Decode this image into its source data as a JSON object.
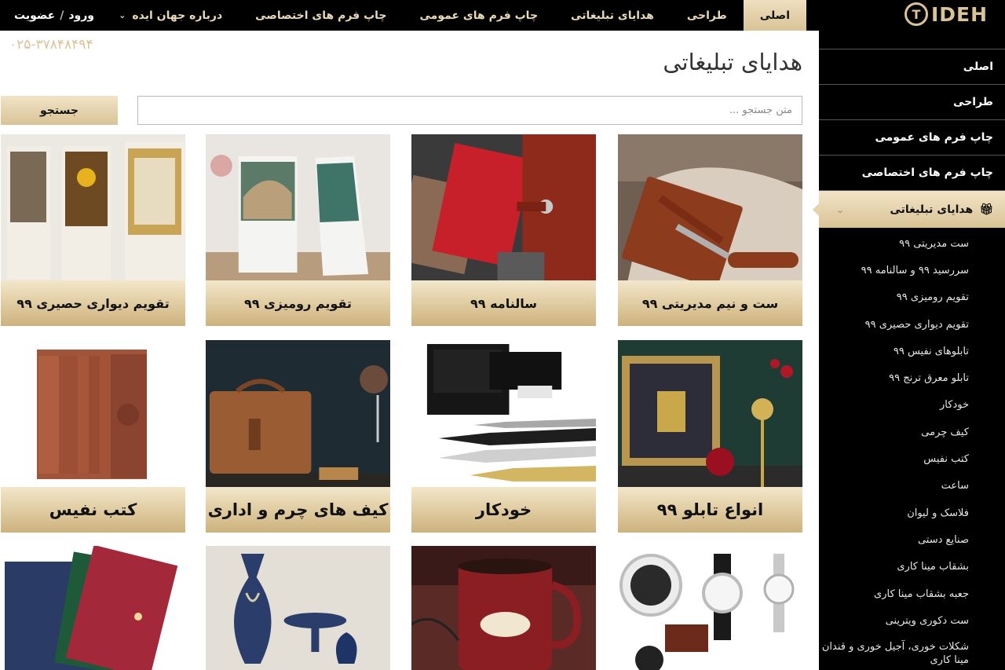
{
  "header": {
    "nav": [
      {
        "label": "اصلی",
        "active": true
      },
      {
        "label": "طراحی"
      },
      {
        "label": "هدایای تبلیغاتی"
      },
      {
        "label": "چاپ فرم های عمومی"
      },
      {
        "label": "چاپ فرم های اختصاصی"
      },
      {
        "label": "درباره جهان ایده",
        "has_dropdown": true
      }
    ],
    "login_label": "ورود",
    "separator": "/",
    "register_label": "عضویت"
  },
  "phone": "۰۲۵-۳۷۸۴۸۴۹۴",
  "page_title": "هدایای تبلیغاتی",
  "search": {
    "placeholder": "متن جستجو ...",
    "button_label": "جستجو"
  },
  "sidebar": {
    "logo_text": "IDEH",
    "logo_mark": "T",
    "items": [
      {
        "label": "اصلی"
      },
      {
        "label": "طراحی"
      },
      {
        "label": "چاپ فرم های عمومی"
      },
      {
        "label": "چاپ فرم های اختصاصی"
      },
      {
        "label": "هدایای تبلیغاتی",
        "active": true,
        "icon": "gift-icon"
      }
    ],
    "sub_items": [
      "ست مدیریتی ۹۹",
      "سررسید ۹۹ و سالنامه ۹۹",
      "تقویم رومیزی ۹۹",
      "تقویم دیواری حصیری ۹۹",
      "تابلوهای نفیس ۹۹",
      "تابلو معرق ترنج ۹۹",
      "خودکار",
      "کیف چرمی",
      "کتب نفیس",
      "ساعت",
      "فلاسک و لیوان",
      "صنایع دستی",
      "بشقاب مینا کاری",
      "جعبه بشقاب مینا کاری",
      "ست دکوری ویترینی",
      "شکلات خوری، آجیل خوری و قندان مینا کاری"
    ]
  },
  "products": [
    {
      "label": "ست و نیم مدیریتی ۹۹"
    },
    {
      "label": "سالنامه ۹۹"
    },
    {
      "label": "تقویم رومیزی ۹۹"
    },
    {
      "label": "تقویم دیواری حصیری ۹۹"
    },
    {
      "label": "انواع تابلو ۹۹"
    },
    {
      "label": "خودکار"
    },
    {
      "label": "کیف های چرم و اداری"
    },
    {
      "label": "کتب نفیس"
    },
    {
      "label": ""
    },
    {
      "label": ""
    },
    {
      "label": ""
    },
    {
      "label": ""
    }
  ],
  "colors": {
    "gold": "#d9c397",
    "black": "#000000"
  }
}
